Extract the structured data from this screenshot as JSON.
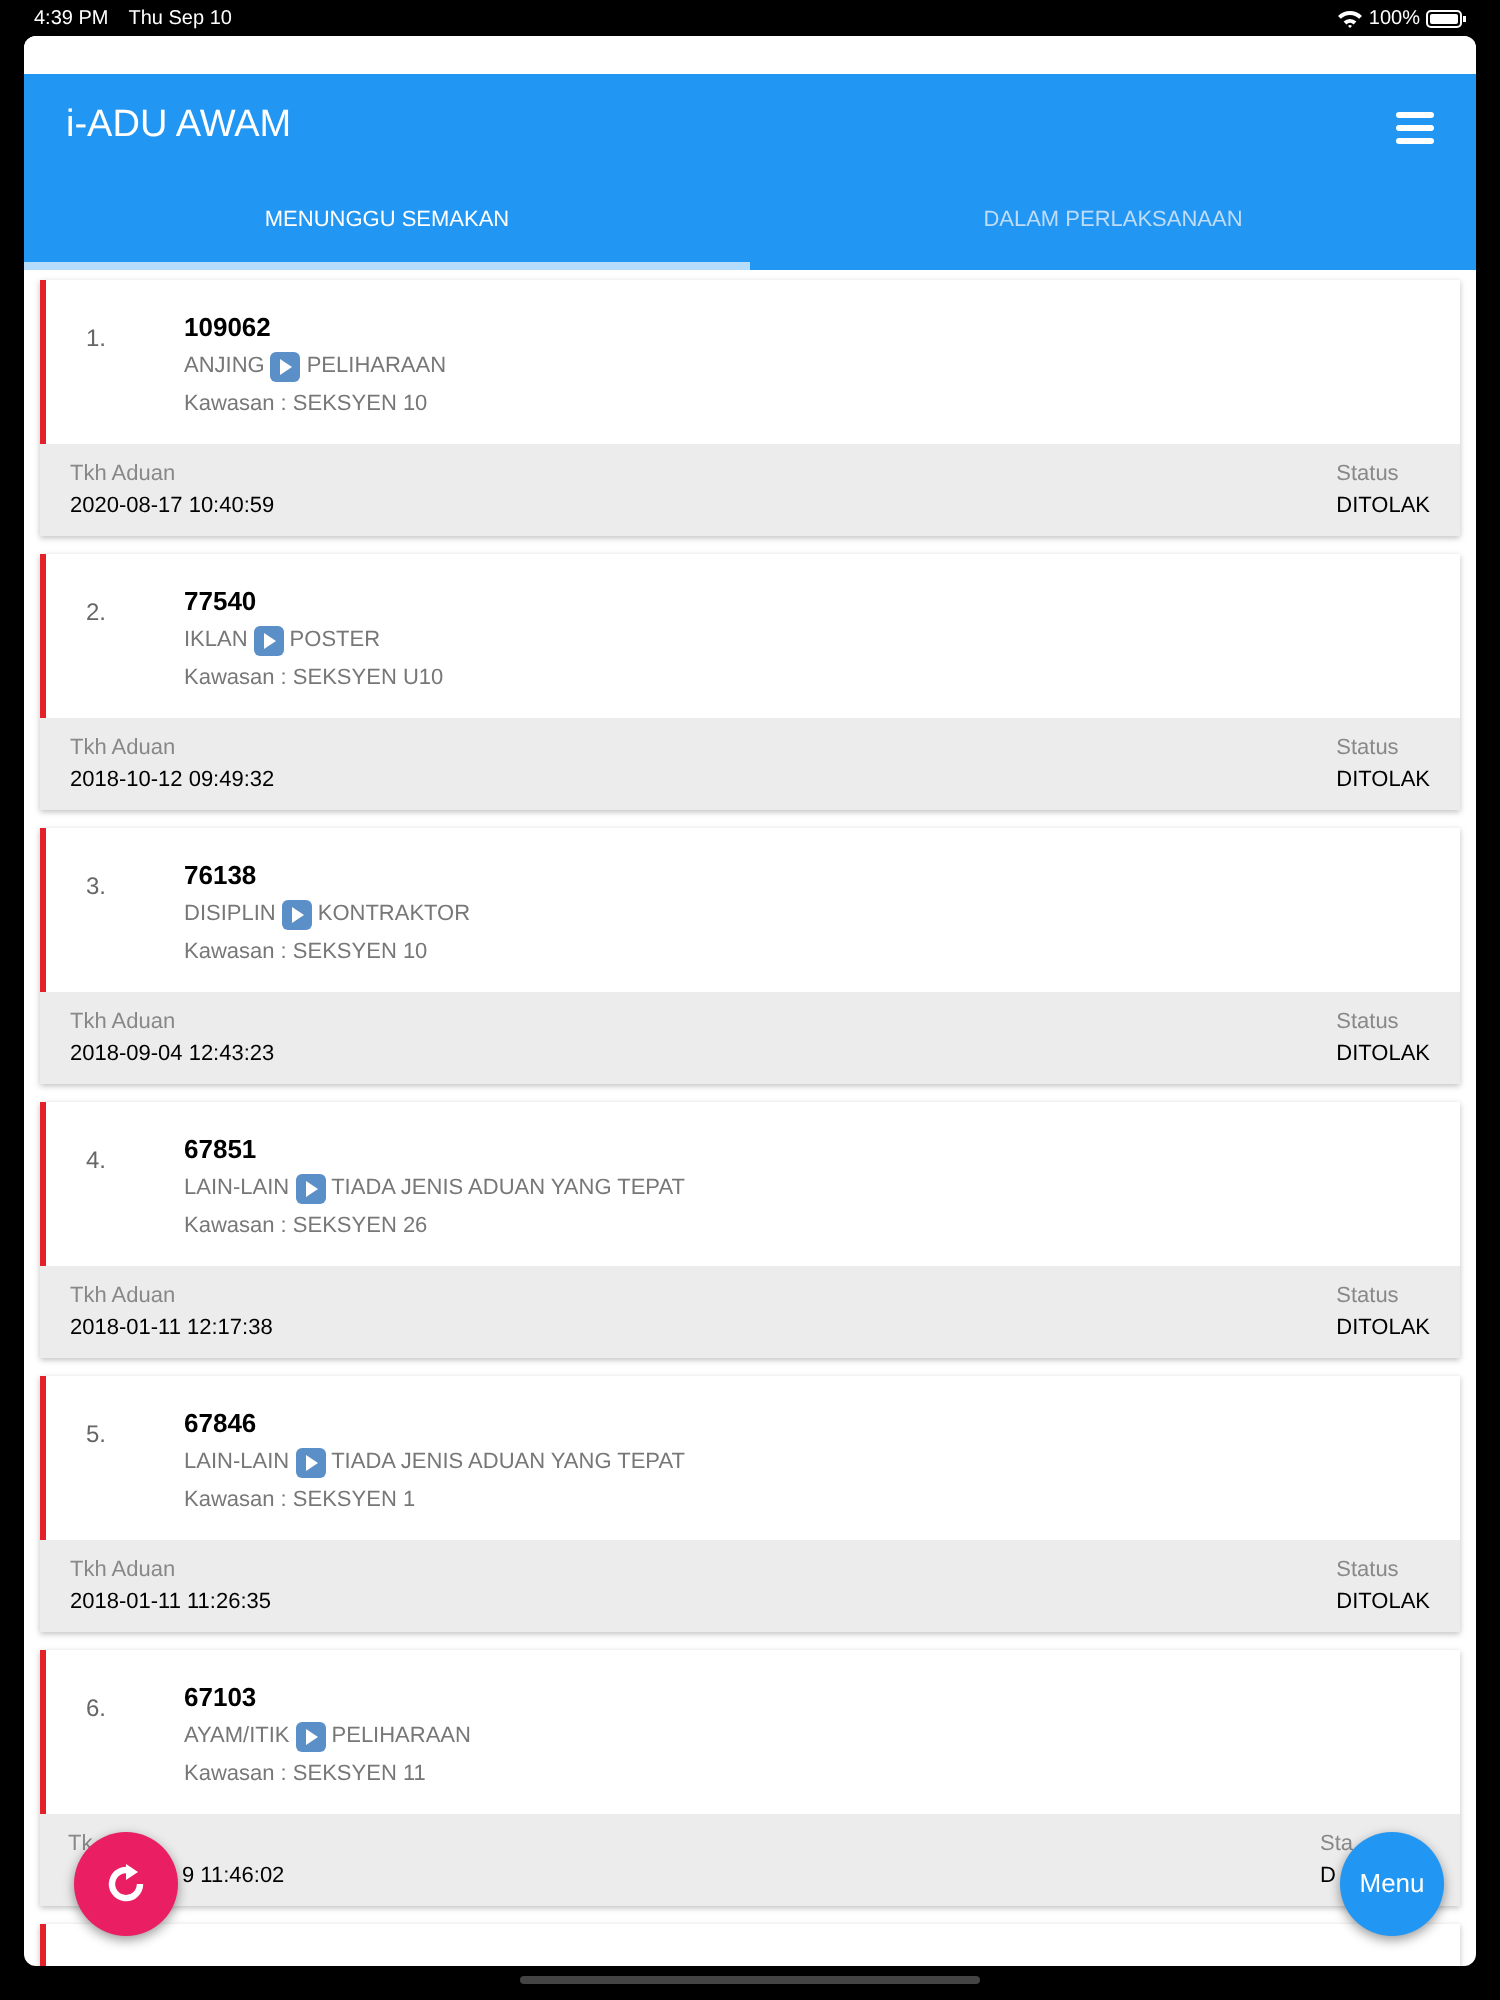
{
  "status_bar": {
    "time": "4:39 PM",
    "date": "Thu Sep 10",
    "battery": "100%"
  },
  "header": {
    "title": "i-ADU AWAM"
  },
  "tabs": [
    {
      "label": "MENUNGGU SEMAKAN",
      "selected": true
    },
    {
      "label": "DALAM PERLAKSANAAN",
      "selected": false
    }
  ],
  "complaints": [
    {
      "number": "1.",
      "id": "109062",
      "category": "ANJING",
      "subcategory": "PELIHARAAN",
      "area": "Kawasan : SEKSYEN 10",
      "date_label": "Tkh Aduan",
      "date": "2020-08-17 10:40:59",
      "status_label": "Status",
      "status": "DITOLAK"
    },
    {
      "number": "2.",
      "id": "77540",
      "category": "IKLAN",
      "subcategory": "POSTER",
      "area": "Kawasan : SEKSYEN U10",
      "date_label": "Tkh Aduan",
      "date": "2018-10-12 09:49:32",
      "status_label": "Status",
      "status": "DITOLAK"
    },
    {
      "number": "3.",
      "id": "76138",
      "category": "DISIPLIN",
      "subcategory": "KONTRAKTOR",
      "area": "Kawasan : SEKSYEN 10",
      "date_label": "Tkh Aduan",
      "date": "2018-09-04 12:43:23",
      "status_label": "Status",
      "status": "DITOLAK"
    },
    {
      "number": "4.",
      "id": "67851",
      "category": "LAIN-LAIN",
      "subcategory": "TIADA JENIS ADUAN YANG TEPAT",
      "area": "Kawasan : SEKSYEN 26",
      "date_label": "Tkh Aduan",
      "date": "2018-01-11 12:17:38",
      "status_label": "Status",
      "status": "DITOLAK"
    },
    {
      "number": "5.",
      "id": "67846",
      "category": "LAIN-LAIN",
      "subcategory": "TIADA JENIS ADUAN YANG TEPAT",
      "area": "Kawasan : SEKSYEN 1",
      "date_label": "Tkh Aduan",
      "date": "2018-01-11 11:26:35",
      "status_label": "Status",
      "status": "DITOLAK"
    },
    {
      "number": "6.",
      "id": "67103",
      "category": "AYAM/ITIK",
      "subcategory": "PELIHARAAN",
      "area": "Kawasan : SEKSYEN 11",
      "date_label": "Tk",
      "date": "9 11:46:02",
      "status_label": "Sta",
      "status": "D",
      "kind": "covered"
    }
  ],
  "fab_menu": {
    "label": "Menu"
  }
}
